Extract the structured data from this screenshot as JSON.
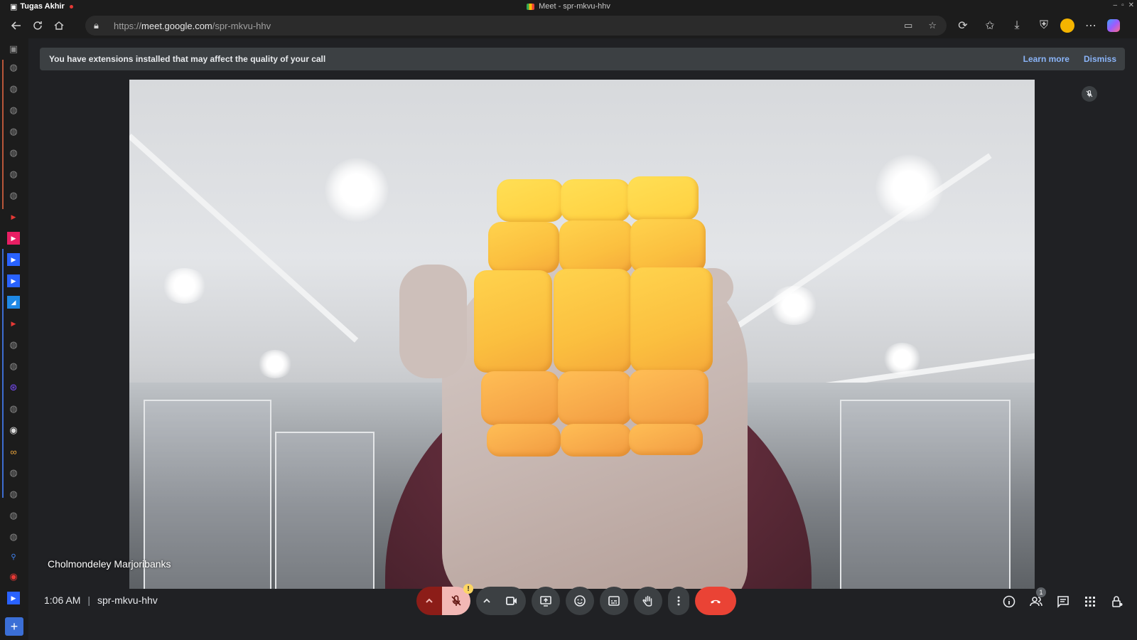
{
  "browser": {
    "profile_name": "Tugas Akhir",
    "window_title": "Meet - spr-mkvu-hhv",
    "url_prefix": "https://",
    "url_host": "meet.google.com",
    "url_path": "/spr-mkvu-hhv"
  },
  "banner": {
    "message": "You have extensions installed that may affect the quality of your call",
    "learn_more": "Learn more",
    "dismiss": "Dismiss"
  },
  "video": {
    "participant_name": "Cholmondeley Marjoribanks",
    "participant_muted": true
  },
  "footer": {
    "time": "1:06 AM",
    "separator": "|",
    "meeting_code": "spr-mkvu-hhv",
    "mic_warning": "!",
    "people_count": "1"
  },
  "colors": {
    "hangup": "#ea4335",
    "mic_off_bg": "#f2b8b5",
    "banner_link": "#8ab4f8"
  }
}
